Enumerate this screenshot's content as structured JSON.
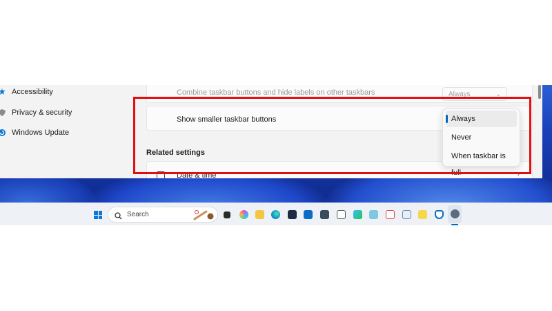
{
  "nav": {
    "items": [
      {
        "label": "Accessibility",
        "icon": "accessibility-icon"
      },
      {
        "label": "Privacy & security",
        "icon": "shield-icon"
      },
      {
        "label": "Windows Update",
        "icon": "windows-update-icon"
      }
    ]
  },
  "content": {
    "combine_label": "Combine taskbar buttons and hide labels on other taskbars",
    "combine_value": "Always",
    "smaller_label": "Show smaller taskbar buttons",
    "related_title": "Related settings",
    "date_time_label": "Date & time"
  },
  "dropdown": {
    "options": [
      "Always",
      "Never",
      "When taskbar is full"
    ],
    "selected": "Always"
  },
  "taskbar": {
    "search_placeholder": "Search",
    "icons": [
      "start-icon",
      "task-view-icon",
      "copilot-icon",
      "file-explorer-icon",
      "edge-icon",
      "store-icon",
      "outlook-icon",
      "calculator-icon",
      "clock-icon",
      "photos-icon",
      "notepad-icon",
      "snipping-tool-icon",
      "paint-icon",
      "sticky-notes-icon",
      "defender-icon",
      "settings-icon"
    ]
  },
  "colors": {
    "highlight": "#e10f0f",
    "accent": "#0067c0",
    "wallpaper": "#1a3fb8"
  }
}
